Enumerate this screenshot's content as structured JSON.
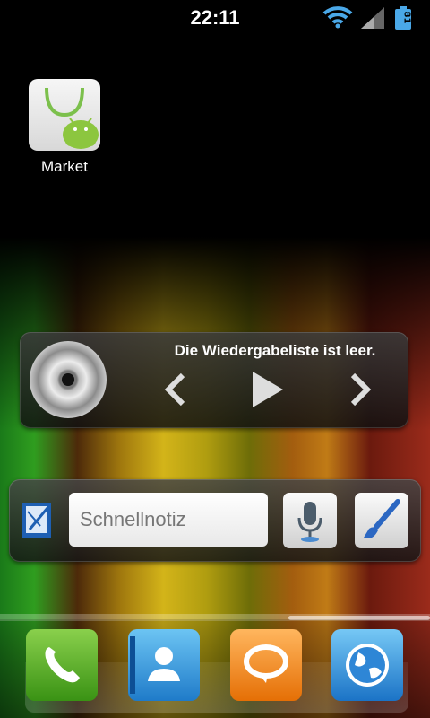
{
  "status_bar": {
    "time": "22:11",
    "battery_text": "81",
    "icons": [
      "wifi-icon",
      "signal-icon",
      "battery-icon"
    ]
  },
  "home": {
    "apps": [
      {
        "label": "Market",
        "icon": "market-bag-icon"
      }
    ]
  },
  "music_widget": {
    "status": "Die Wiedergabeliste ist leer.",
    "controls": [
      "previous",
      "play",
      "next"
    ]
  },
  "note_widget": {
    "placeholder": "Schnellnotiz",
    "buttons": [
      "voice-input",
      "draw"
    ]
  },
  "dock": {
    "apps": [
      "phone",
      "contacts",
      "messages",
      "browser"
    ]
  },
  "colors": {
    "accent_blue": "#4aa8e8",
    "dock_green": "#3a9214",
    "dock_orange": "#e56f05"
  }
}
